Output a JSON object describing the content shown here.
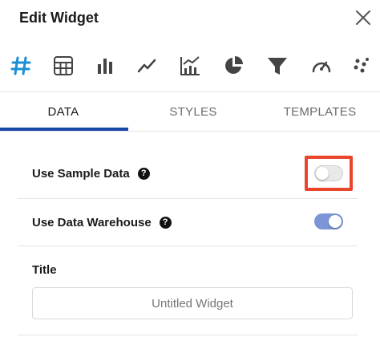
{
  "header": {
    "title": "Edit Widget"
  },
  "widget_types": [
    {
      "icon": "number-icon"
    },
    {
      "icon": "table-icon"
    },
    {
      "icon": "bar-chart-icon"
    },
    {
      "icon": "line-chart-icon"
    },
    {
      "icon": "combo-chart-icon"
    },
    {
      "icon": "pie-chart-icon"
    },
    {
      "icon": "funnel-icon"
    },
    {
      "icon": "gauge-icon"
    },
    {
      "icon": "scatter-icon"
    }
  ],
  "tabs": [
    {
      "label": "DATA",
      "active": true
    },
    {
      "label": "STYLES",
      "active": false
    },
    {
      "label": "TEMPLATES",
      "active": false
    }
  ],
  "settings": {
    "sample_data": {
      "label": "Use Sample Data",
      "help": "?",
      "enabled": false
    },
    "data_warehouse": {
      "label": "Use Data Warehouse",
      "help": "?",
      "enabled": true
    }
  },
  "title_field": {
    "label": "Title",
    "placeholder": "Untitled Widget",
    "value": ""
  },
  "colors": {
    "accent": "#1747a6",
    "icon_active": "#1d8fd3",
    "icon": "#444444",
    "toggle_on": "#7b95d6",
    "highlight": "#e8452a"
  }
}
